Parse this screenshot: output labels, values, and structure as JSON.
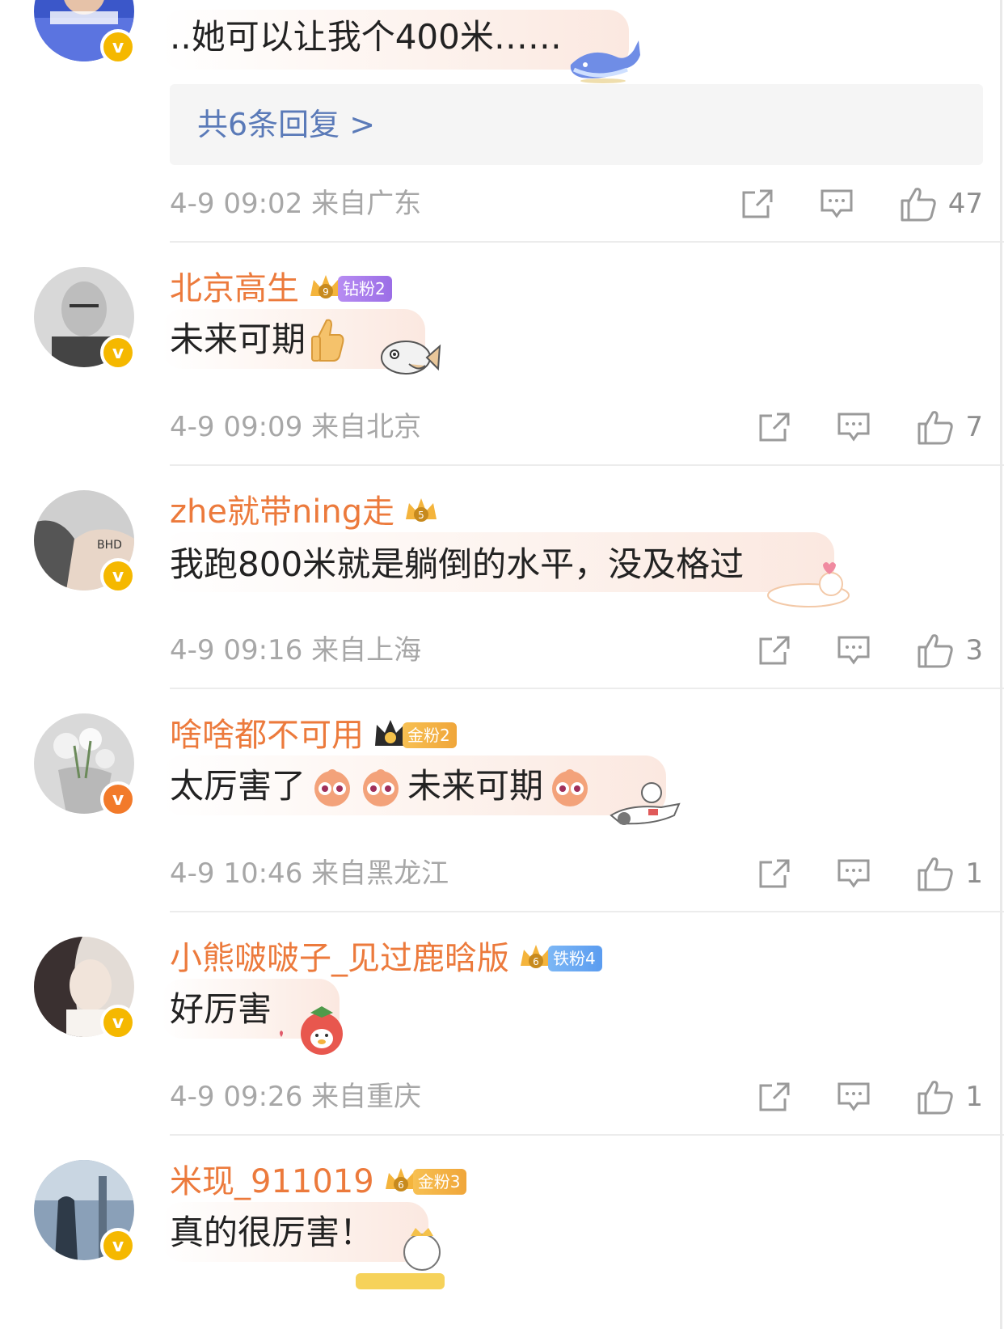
{
  "comments": [
    {
      "username": "",
      "content": "..她可以让我个400米……",
      "verified_color": "#f5b800",
      "replies_label": "共6条回复 >",
      "time_location": "4-9 09:02 来自广东",
      "likes": "47",
      "bubble_deco": "whale-sticker"
    },
    {
      "username": "北京高生",
      "fan_badge": "钻粉2",
      "crown_level": "9",
      "content": "未来可期",
      "emoji": [
        "thumbs-up-emoji"
      ],
      "verified_color": "#f5b800",
      "time_location": "4-9 09:09 来自北京",
      "likes": "7",
      "bubble_deco": "fish-sticker"
    },
    {
      "username": "zhe就带ning走",
      "crown_level": "5",
      "content": "我跑800米就是躺倒的水平，没及格过",
      "verified_color": "#f5b800",
      "time_location": "4-9 09:16 来自上海",
      "likes": "3",
      "bubble_deco": "cat-sticker"
    },
    {
      "username": "啥啥都不可用",
      "fan_badge": "金粉2",
      "content_parts": [
        "太厉害了",
        "未来可期"
      ],
      "emoji": [
        "doge-emoji",
        "doge-emoji",
        "doge-emoji"
      ],
      "verified_color": "#f27a2a",
      "time_location": "4-9 10:46 来自黑龙江",
      "likes": "1",
      "bubble_deco": "plane-sticker"
    },
    {
      "username": "小熊啵啵子_见过鹿晗版",
      "fan_badge": "铁粉4",
      "crown_level": "6",
      "content": "好厉害",
      "verified_color": "#f5b800",
      "time_location": "4-9 09:26 来自重庆",
      "likes": "1",
      "bubble_deco": "strawberry-sticker"
    },
    {
      "username": "米现_911019",
      "fan_badge": "金粉3",
      "crown_level": "6",
      "content": "真的很厉害！",
      "verified_color": "#f5b800",
      "bubble_deco": "crown-sticker"
    }
  ],
  "verified_mark": "v",
  "icons": {
    "share": "share-icon",
    "comment": "comment-icon",
    "like": "thumbs-up-icon"
  }
}
